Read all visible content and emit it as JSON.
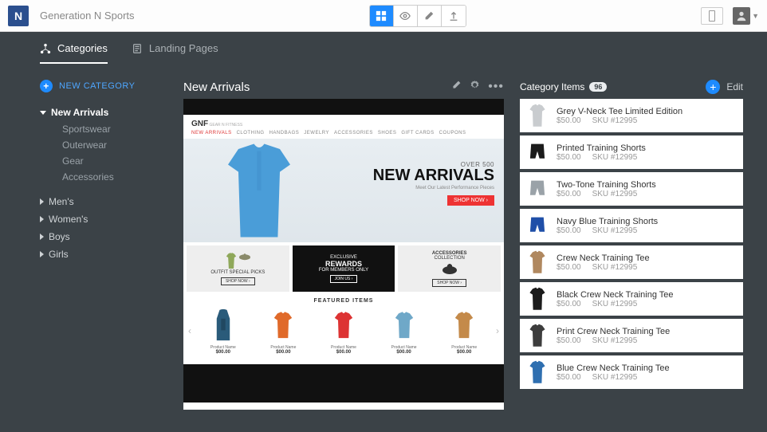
{
  "header": {
    "brand": "Generation N Sports"
  },
  "tabs": {
    "categories": "Categories",
    "landing_pages": "Landing Pages"
  },
  "sidebar": {
    "new_category": "NEW CATEGORY",
    "selected": "New Arrivals",
    "selected_children": [
      "Sportswear",
      "Outerwear",
      "Gear",
      "Accessories"
    ],
    "collapsed": [
      "Men's",
      "Women's",
      "Boys",
      "Girls"
    ]
  },
  "center": {
    "title": "New Arrivals",
    "preview_nav": [
      "NEW ARRIVALS",
      "CLOTHING",
      "HANDBAGS",
      "JEWELRY",
      "ACCESSORIES",
      "SHOES",
      "GIFT CARDS",
      "COUPONS"
    ],
    "hero_over": "OVER 500",
    "hero_main": "NEW ARRIVALS",
    "hero_sub": "Meet Our Latest Performance Pieces",
    "hero_btn": "SHOP NOW ›",
    "promo1_sub": "OUTFIT SPECIAL PICKS",
    "promo1_btn": "SHOP NOW ›",
    "promo2_pre": "EXCLUSIVE",
    "promo2_title": "REWARDS",
    "promo2_sub": "FOR MEMBERS ONLY",
    "promo2_btn": "JOIN US ›",
    "promo3_title": "ACCESSORIES",
    "promo3_sub": "COLLECTION",
    "promo3_btn": "SHOP NOW ›",
    "featured_title": "FEATURED ITEMS"
  },
  "panel": {
    "title": "Category Items",
    "count": "96",
    "edit": "Edit",
    "items": [
      {
        "name": "Grey V-Neck Tee Limited Edition",
        "price": "$50.00",
        "sku": "SKU #12995",
        "color": "#c9cccf",
        "shape": "tee"
      },
      {
        "name": "Printed Training Shorts",
        "price": "$50.00",
        "sku": "SKU #12995",
        "color": "#1b1b1b",
        "shape": "shorts"
      },
      {
        "name": "Two-Tone Training Shorts",
        "price": "$50.00",
        "sku": "SKU #12995",
        "color": "#9aa2a8",
        "shape": "shorts"
      },
      {
        "name": "Navy Blue Training Shorts",
        "price": "$50.00",
        "sku": "SKU #12995",
        "color": "#1f4fa8",
        "shape": "shorts"
      },
      {
        "name": "Crew Neck Training Tee",
        "price": "$50.00",
        "sku": "SKU #12995",
        "color": "#b0885f",
        "shape": "tee"
      },
      {
        "name": "Black Crew Neck Training Tee",
        "price": "$50.00",
        "sku": "SKU #12995",
        "color": "#1b1b1b",
        "shape": "tee"
      },
      {
        "name": "Print Crew Neck Training Tee",
        "price": "$50.00",
        "sku": "SKU #12995",
        "color": "#3d3d3d",
        "shape": "tee"
      },
      {
        "name": "Blue Crew Neck Training Tee",
        "price": "$50.00",
        "sku": "SKU #12995",
        "color": "#2f6fb0",
        "shape": "tee"
      }
    ]
  },
  "featured_products": [
    {
      "color": "#2a5b7a",
      "shape": "bag"
    },
    {
      "color": "#e06a2a",
      "shape": "tee"
    },
    {
      "color": "#d33",
      "shape": "tee"
    },
    {
      "color": "#6fa8c8",
      "shape": "tee"
    },
    {
      "color": "#c48a4a",
      "shape": "tee"
    }
  ]
}
